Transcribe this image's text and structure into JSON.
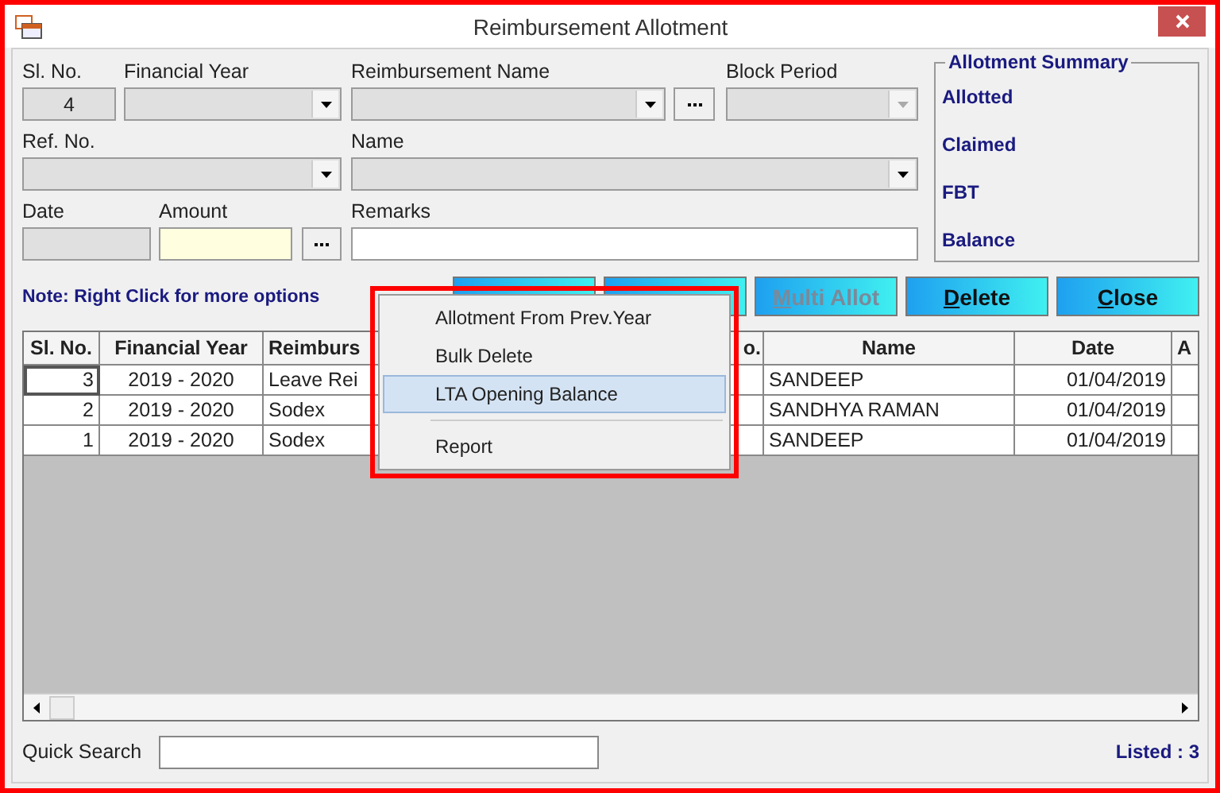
{
  "window": {
    "title": "Reimbursement Allotment"
  },
  "form": {
    "sl_no": {
      "label": "Sl. No.",
      "value": "4"
    },
    "financial_year": {
      "label": "Financial Year",
      "disabled": false
    },
    "reimbursement_name": {
      "label": "Reimbursement Name",
      "disabled": false
    },
    "block_period": {
      "label": "Block Period",
      "disabled": true
    },
    "ref_no": {
      "label": "Ref. No.",
      "disabled": false
    },
    "name": {
      "label": "Name",
      "disabled": false
    },
    "date": {
      "label": "Date"
    },
    "amount": {
      "label": "Amount"
    },
    "remarks": {
      "label": "Remarks"
    }
  },
  "summary": {
    "title": "Allotment Summary",
    "items": [
      "Allotted",
      "Claimed",
      "FBT",
      "Balance"
    ]
  },
  "note": "Note: Right Click for more options",
  "buttons": [
    {
      "kind": "blank"
    },
    {
      "kind": "blank"
    },
    {
      "kind": "text",
      "label": "Multi Allot",
      "disabled": true
    },
    {
      "kind": "text",
      "label": "Delete",
      "disabled": false
    },
    {
      "kind": "text",
      "label": "Close",
      "disabled": false
    }
  ],
  "table": {
    "columns": [
      "Sl. No.",
      "Financial Year",
      "Reimburs",
      "",
      "o.",
      "Name",
      "Date",
      "A"
    ],
    "rows": [
      {
        "sl_no": "3",
        "year": "2019 - 2020",
        "reimbursement": "Leave Rei",
        "name": "SANDEEP",
        "date": "01/04/2019",
        "selected": true
      },
      {
        "sl_no": "2",
        "year": "2019 - 2020",
        "reimbursement": "Sodex",
        "name": "SANDHYA RAMAN",
        "date": "01/04/2019",
        "selected": false
      },
      {
        "sl_no": "1",
        "year": "2019 - 2020",
        "reimbursement": "Sodex",
        "name": "SANDEEP",
        "date": "01/04/2019",
        "selected": false
      }
    ]
  },
  "context_menu": {
    "items": [
      {
        "kind": "item",
        "label": "Allotment From Prev.Year",
        "selected": false
      },
      {
        "kind": "item",
        "label": "Bulk Delete",
        "selected": false
      },
      {
        "kind": "item",
        "label": "LTA Opening Balance",
        "selected": true
      },
      {
        "kind": "separator"
      },
      {
        "kind": "item",
        "label": "Report",
        "selected": false
      }
    ]
  },
  "quick_search": {
    "label": "Quick Search"
  },
  "status": "Listed : 3"
}
